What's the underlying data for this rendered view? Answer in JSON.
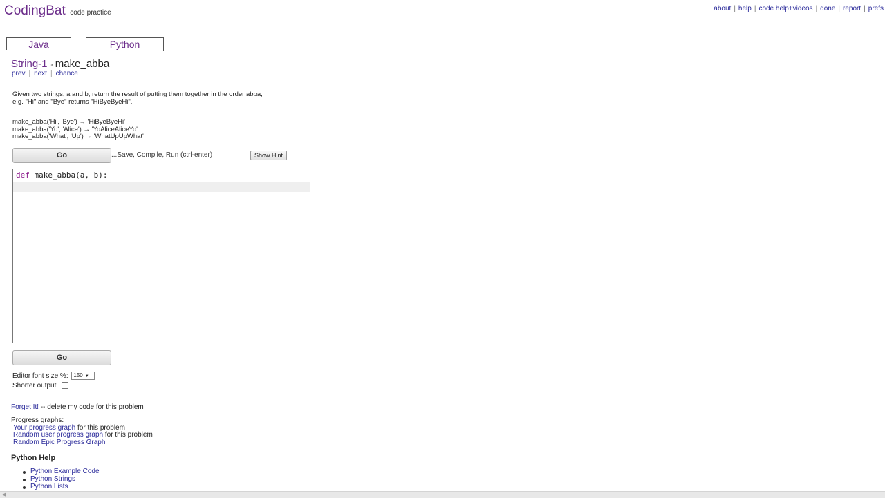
{
  "brand": {
    "logo": "CodingBat",
    "tagline": "code practice"
  },
  "top_links": [
    "about",
    "help",
    "code help+videos",
    "done",
    "report",
    "prefs"
  ],
  "tabs": [
    {
      "label": "Java",
      "active": false
    },
    {
      "label": "Python",
      "active": true
    }
  ],
  "breadcrumb": {
    "section": "String-1",
    "separator": ">",
    "problem": "make_abba"
  },
  "problem_nav": [
    "prev",
    "next",
    "chance"
  ],
  "description": {
    "line1": "Given two strings, a and b, return the result of putting them together in the order abba,",
    "line2": "e.g. \"Hi\" and \"Bye\" returns \"HiByeByeHi\"."
  },
  "examples": [
    "make_abba('Hi', 'Bye') → 'HiByeByeHi'",
    "make_abba('Yo', 'Alice') → 'YoAliceAliceYo'",
    "make_abba('What', 'Up') → 'WhatUpUpWhat'"
  ],
  "controls": {
    "go_label": "Go",
    "run_note": "...Save, Compile, Run (ctrl-enter)",
    "hint_label": "Show Hint"
  },
  "editor": {
    "keyword": "def",
    "signature": " make_abba(a, b):"
  },
  "options": {
    "font_size_label": "Editor font size %:",
    "font_size_value": "150",
    "shorter_output_label": "Shorter output",
    "shorter_output_checked": false
  },
  "forget": {
    "link": "Forget It!",
    "text": " -- delete my code for this problem"
  },
  "progress": {
    "heading": "Progress graphs:",
    "your_link": "Your progress graph",
    "your_suffix": " for this problem",
    "random_user_link": "Random user progress graph",
    "random_user_suffix": " for this problem",
    "epic_link": "Random Epic Progress Graph"
  },
  "python_help": {
    "heading": "Python Help",
    "links": [
      "Python Example Code",
      "Python Strings",
      "Python Lists"
    ]
  },
  "colors": {
    "brand": "#6b2c8a",
    "link": "#2a2a9a",
    "keyword": "#8b1a8b"
  }
}
